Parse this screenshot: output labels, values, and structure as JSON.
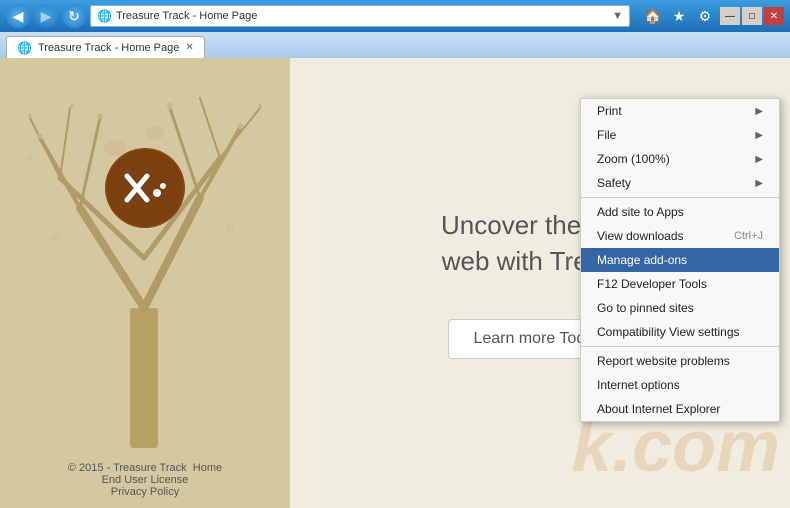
{
  "window": {
    "title": "Treasure Track - Home Page"
  },
  "titlebar": {
    "back_label": "◀",
    "forward_label": "▶",
    "refresh_label": "↻",
    "address": "Treasure Track - Home Page",
    "address_icon": "🌐",
    "search_icon": "🔍",
    "tab_label": "Treasure Track - Home Page",
    "tab_close": "✕",
    "home_icon": "🏠",
    "favorites_icon": "★",
    "settings_icon": "⚙"
  },
  "win_controls": {
    "minimize": "—",
    "maximize": "□",
    "close": "✕"
  },
  "page": {
    "heading_line1": "Uncover the gem",
    "heading_line2": "web with Treasur",
    "learn_btn": "Learn more Today!",
    "footer_copyright": "© 2015 - Treasure Track",
    "footer_home": "Home",
    "footer_eula": "End User License",
    "footer_privacy": "Privacy Policy",
    "watermark": "k.com"
  },
  "context_menu": {
    "items": [
      {
        "label": "Print",
        "arrow": "▶",
        "shortcut": "",
        "highlighted": false
      },
      {
        "label": "File",
        "arrow": "▶",
        "shortcut": "",
        "highlighted": false
      },
      {
        "label": "Zoom (100%)",
        "arrow": "▶",
        "shortcut": "",
        "highlighted": false
      },
      {
        "label": "Safety",
        "arrow": "▶",
        "shortcut": "",
        "highlighted": false
      },
      {
        "label": "separator1"
      },
      {
        "label": "Add site to Apps",
        "arrow": "",
        "shortcut": "",
        "highlighted": false
      },
      {
        "label": "View downloads",
        "arrow": "",
        "shortcut": "Ctrl+J",
        "highlighted": false
      },
      {
        "label": "Manage add-ons",
        "arrow": "",
        "shortcut": "",
        "highlighted": true
      },
      {
        "label": "F12 Developer Tools",
        "arrow": "",
        "shortcut": "",
        "highlighted": false
      },
      {
        "label": "Go to pinned sites",
        "arrow": "",
        "shortcut": "",
        "highlighted": false
      },
      {
        "label": "Compatibility View settings",
        "arrow": "",
        "shortcut": "",
        "highlighted": false
      },
      {
        "label": "separator2"
      },
      {
        "label": "Report website problems",
        "arrow": "",
        "shortcut": "",
        "highlighted": false
      },
      {
        "label": "Internet options",
        "arrow": "",
        "shortcut": "",
        "highlighted": false
      },
      {
        "label": "About Internet Explorer",
        "arrow": "",
        "shortcut": "",
        "highlighted": false
      }
    ]
  }
}
